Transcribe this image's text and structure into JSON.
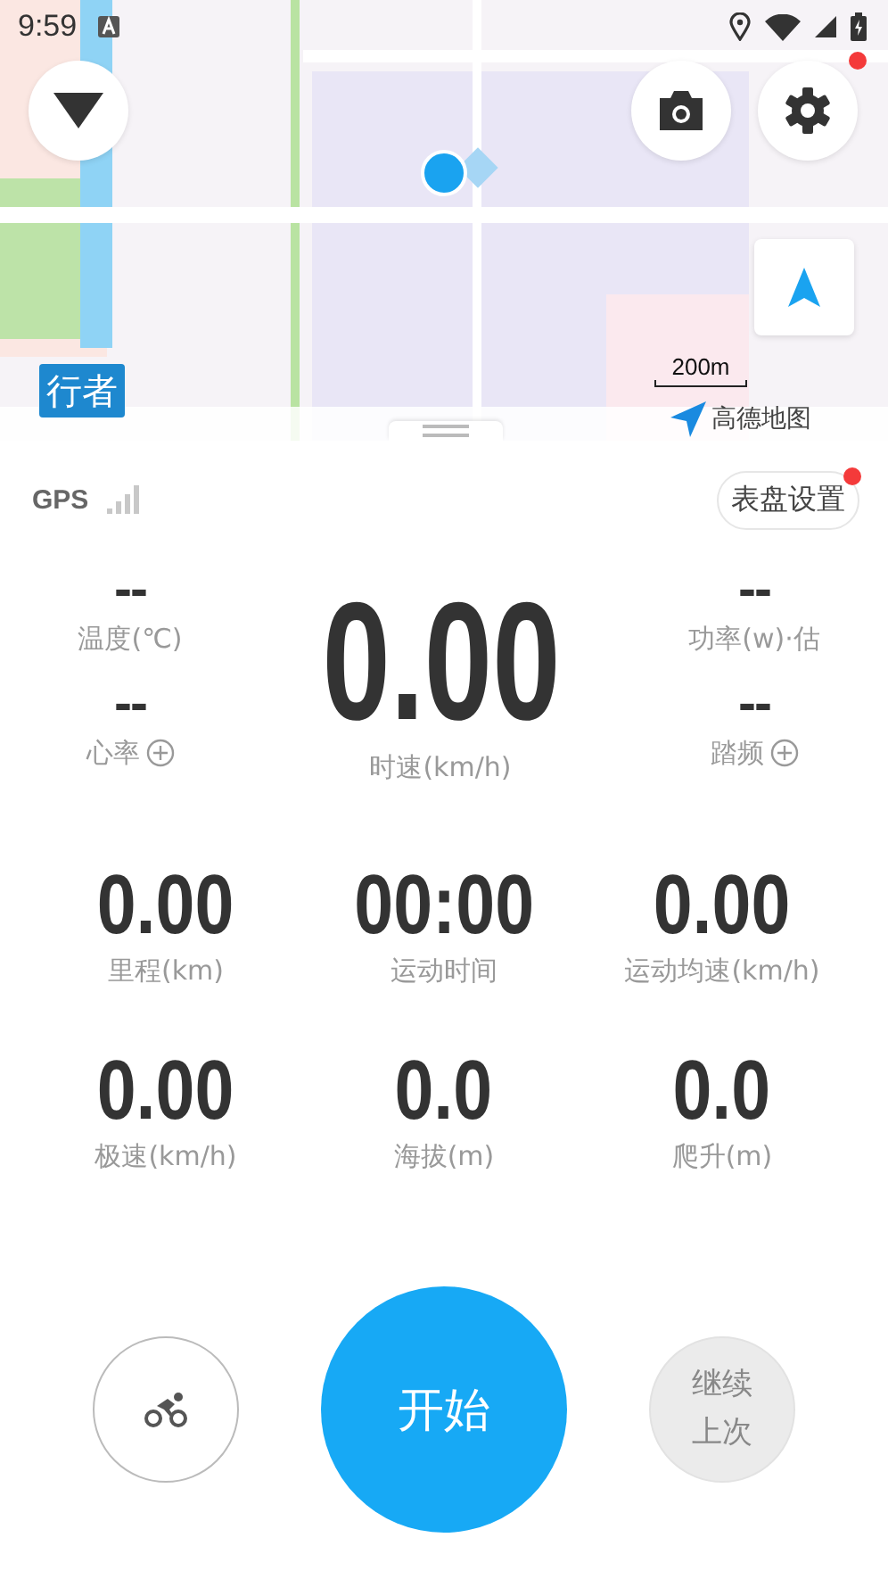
{
  "status_bar": {
    "time": "9:59"
  },
  "map": {
    "kind": "picture",
    "mode_badge": "行者",
    "scale": "200m",
    "provider": "高德地图"
  },
  "map_controls": {
    "settings_badge": true
  },
  "gps": {
    "label": "GPS"
  },
  "dial_settings": {
    "label": "表盘设置",
    "badge": true
  },
  "main_metric": {
    "value": "0.00",
    "label": "时速(km/h)"
  },
  "left_metrics": [
    {
      "value": "--",
      "label": "温度(℃)",
      "addable": false
    },
    {
      "value": "--",
      "label": "心率",
      "addable": true
    }
  ],
  "right_metrics": [
    {
      "value": "--",
      "label": "功率(w)·估",
      "addable": false
    },
    {
      "value": "--",
      "label": "踏频",
      "addable": true
    }
  ],
  "metrics": [
    {
      "value": "0.00",
      "label": "里程(km)"
    },
    {
      "value": "00:00",
      "label": "运动时间"
    },
    {
      "value": "0.00",
      "label": "运动均速(km/h)"
    },
    {
      "value": "0.00",
      "label": "极速(km/h)"
    },
    {
      "value": "0.0",
      "label": "海拔(m)"
    },
    {
      "value": "0.0",
      "label": "爬升(m)"
    }
  ],
  "buttons": [
    {
      "kind": "sport"
    },
    {
      "kind": "start",
      "label": "开始"
    },
    {
      "kind": "resume",
      "label": "继续上次"
    }
  ]
}
